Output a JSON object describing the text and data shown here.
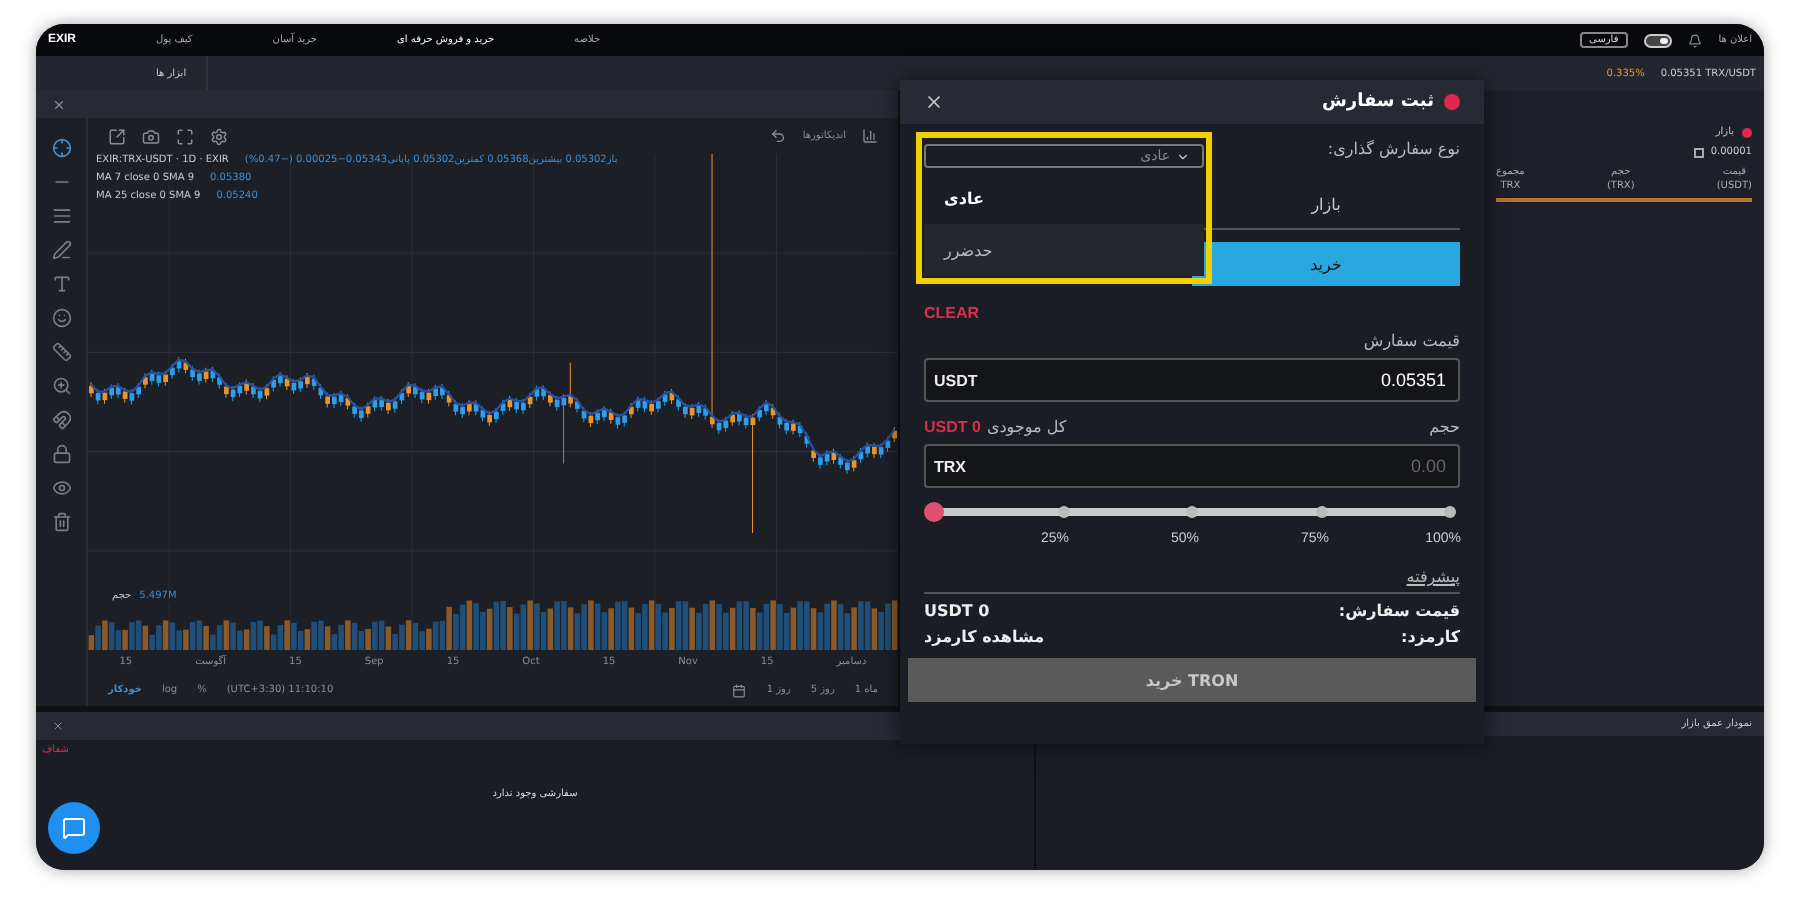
{
  "nav": {
    "logo": "EXIR",
    "items": [
      {
        "label": "خلاصه",
        "selected": false
      },
      {
        "label": "خرید و فروش حرفه ای",
        "selected": true
      },
      {
        "label": "خرید آسان",
        "selected": false
      },
      {
        "label": "کیف پول",
        "selected": false
      }
    ],
    "language": "فارسی",
    "theme_toggle": {
      "on": true
    },
    "notifications": "اعلان ها"
  },
  "subbar": {
    "tab": "ابزار ها",
    "change": "0.335%",
    "ticker": "0.05351 TRX/USDT"
  },
  "chart_panel": {
    "indicators": "اندیکاتورها",
    "symbol": "EXIR:TRX-USDT · 1D · EXIR",
    "ohlc": "باز0.05302 بیشترین0.05368 کمترین0.05302 پایانی0.05343−0.00025 (−0.47%)",
    "ma_lines": [
      {
        "label": "MA 7 close 0 SMA 9",
        "value": "0.05380"
      },
      {
        "label": "MA 25 close 0 SMA 9",
        "value": "0.05240"
      }
    ],
    "volume_label": "حجم",
    "volume_value": "5.497M",
    "x_labels": [
      "دسامبر",
      "15",
      "Nov",
      "15",
      "Oct",
      "15",
      "Sep",
      "15",
      "آگوست",
      "15"
    ],
    "scales": [
      {
        "label": "%",
        "selected": false
      },
      {
        "label": "log",
        "selected": false
      },
      {
        "label": "خودکار",
        "selected": true
      }
    ],
    "time": "(UTC+3:30) 11:10:10",
    "ranges": [
      "1 ماه",
      "5 روز",
      "1 روز"
    ]
  },
  "orders_panel": {
    "tag": "شفاف",
    "empty": "سفارشی وجود ندارد"
  },
  "market_panel": {
    "title": "بازار",
    "precision": "0.00001",
    "precision_checked": false,
    "columns": [
      {
        "label": "قیمت",
        "unit": "(USDT)"
      },
      {
        "label": "حجم",
        "unit": "(TRX)"
      },
      {
        "label": "مجموع",
        "unit": "TRX"
      }
    ]
  },
  "depth_panel": {
    "title": "نمودار عمق بازار"
  },
  "modal": {
    "title": "ثبت سفارش",
    "order_type_label": "نوع سفارش گذاری:",
    "order_type_value": "عادی",
    "dropdown": {
      "expanded": true,
      "highlighted": true,
      "options": [
        {
          "label": "عادی",
          "selected": true
        },
        {
          "label": "حدضرر",
          "selected": false
        }
      ]
    },
    "mode_tabs": [
      {
        "label": "بازار",
        "selected": false
      }
    ],
    "side_tabs": [
      {
        "label": "خرید",
        "selected": true
      }
    ],
    "clear": "CLEAR",
    "price_label": "قیمت سفارش",
    "price": {
      "unit": "USDT",
      "value": "0.05351"
    },
    "amount_label": "حجم",
    "balance_label": "کل موجودی",
    "balance": "USDT 0",
    "amount": {
      "unit": "TRX",
      "placeholder": "0.00"
    },
    "slider": {
      "level": 0,
      "marks": [
        "100%",
        "75%",
        "50%",
        "25%"
      ]
    },
    "advanced": "پیشرفته",
    "summary": [
      {
        "label": "قیمت سفارش:",
        "value": "USDT 0"
      },
      {
        "label": "کارمزد:",
        "value": "مشاهده کارمزد"
      }
    ],
    "submit": {
      "label": "خرید TRON",
      "disabled": true
    }
  }
}
